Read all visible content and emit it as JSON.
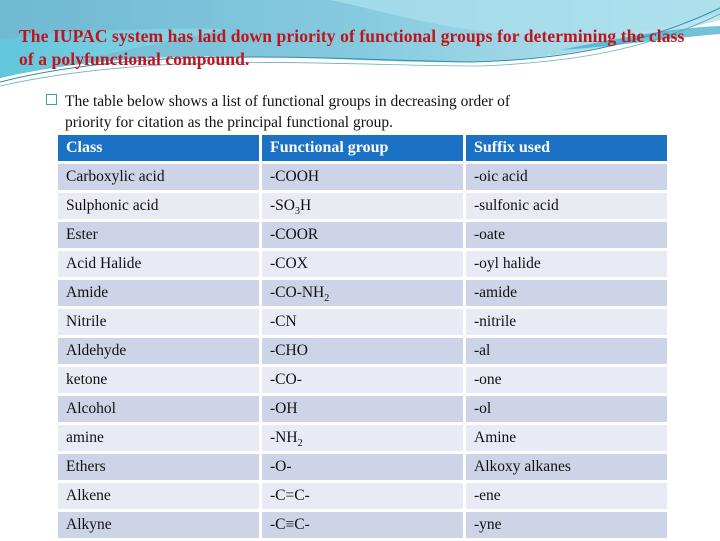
{
  "slide": {
    "title": "The IUPAC system has laid down priority of functional groups for determining the class of a polyfunctional compound.",
    "bullet": {
      "icon": "square-bullet-icon",
      "line1": "The table below shows a list of functional groups in decreasing order of",
      "line2": "priority for citation as the principal functional group."
    },
    "colors": {
      "title": "#c0141c",
      "header_bg": "#1b72c4",
      "row_dark": "#cdd4e7",
      "row_light": "#e8ebf4"
    }
  },
  "table": {
    "headers": [
      "Class",
      "Functional group",
      "Suffix used"
    ],
    "rows": [
      {
        "class": "Carboxylic acid",
        "group": "-COOH",
        "group_sub": "",
        "group_after": "",
        "suffix": "-oic acid"
      },
      {
        "class": "Sulphonic acid",
        "group": "-SO",
        "group_sub": "3",
        "group_after": "H",
        "suffix": "-sulfonic acid"
      },
      {
        "class": "Ester",
        "group": "-COOR",
        "group_sub": "",
        "group_after": "",
        "suffix": "-oate"
      },
      {
        "class": "Acid Halide",
        "group": "-COX",
        "group_sub": "",
        "group_after": "",
        "suffix": "-oyl halide"
      },
      {
        "class": "Amide",
        "group": "-CO-NH",
        "group_sub": "2",
        "group_after": "",
        "suffix": "-amide"
      },
      {
        "class": "Nitrile",
        "group": "-CN",
        "group_sub": "",
        "group_after": "",
        "suffix": "-nitrile"
      },
      {
        "class": "Aldehyde",
        "group": "-CHO",
        "group_sub": "",
        "group_after": "",
        "suffix": "-al"
      },
      {
        "class": "ketone",
        "group": "-CO-",
        "group_sub": "",
        "group_after": "",
        "suffix": "-one"
      },
      {
        "class": "Alcohol",
        "group": "-OH",
        "group_sub": "",
        "group_after": "",
        "suffix": "-ol"
      },
      {
        "class": "amine",
        "group": "-NH",
        "group_sub": "2",
        "group_after": "",
        "suffix": "Amine"
      },
      {
        "class": "Ethers",
        "group": "-O-",
        "group_sub": "",
        "group_after": "",
        "suffix": "Alkoxy alkanes"
      },
      {
        "class": "Alkene",
        "group": "-C=C-",
        "group_sub": "",
        "group_after": "",
        "suffix": "-ene"
      },
      {
        "class": "Alkyne",
        "group": "-C≡C-",
        "group_sub": "",
        "group_after": "",
        "suffix": "-yne"
      }
    ]
  }
}
